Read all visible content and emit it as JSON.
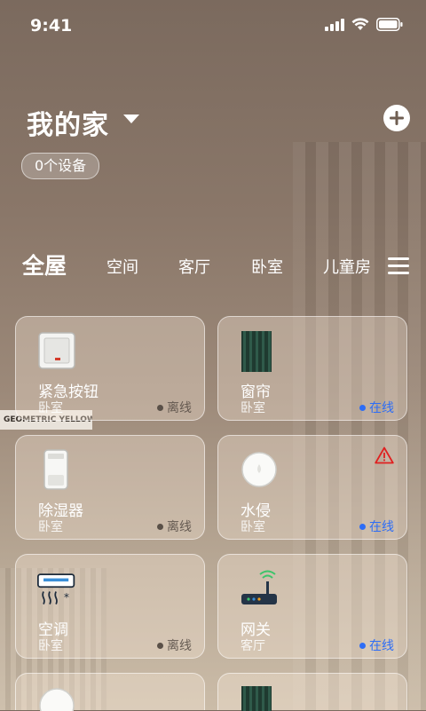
{
  "status_bar": {
    "time": "9:41"
  },
  "header": {
    "home_name": "我的家",
    "device_count": "0个设备"
  },
  "tabs": [
    {
      "label": "全屋",
      "active": true
    },
    {
      "label": "空间"
    },
    {
      "label": "客厅"
    },
    {
      "label": "卧室"
    },
    {
      "label": "儿童房"
    }
  ],
  "background_text": "GEOMETRIC YELLOW",
  "devices": [
    {
      "name": "紧急按钮",
      "room": "卧室",
      "status": "离线",
      "icon": "emergency-button-icon"
    },
    {
      "name": "窗帘",
      "room": "卧室",
      "status": "在线",
      "icon": "curtain-icon"
    },
    {
      "name": "除湿器",
      "room": "卧室",
      "status": "离线",
      "icon": "dehumidifier-icon"
    },
    {
      "name": "水侵",
      "room": "卧室",
      "status": "在线",
      "icon": "water-leak-sensor-icon",
      "warning": true
    },
    {
      "name": "空调",
      "room": "卧室",
      "status": "离线",
      "icon": "air-conditioner-icon"
    },
    {
      "name": "网关",
      "room": "客厅",
      "status": "在线",
      "icon": "gateway-router-icon"
    }
  ],
  "colors": {
    "online": "#2d6df6",
    "offline": "#5a5048",
    "warning": "#e02020"
  }
}
